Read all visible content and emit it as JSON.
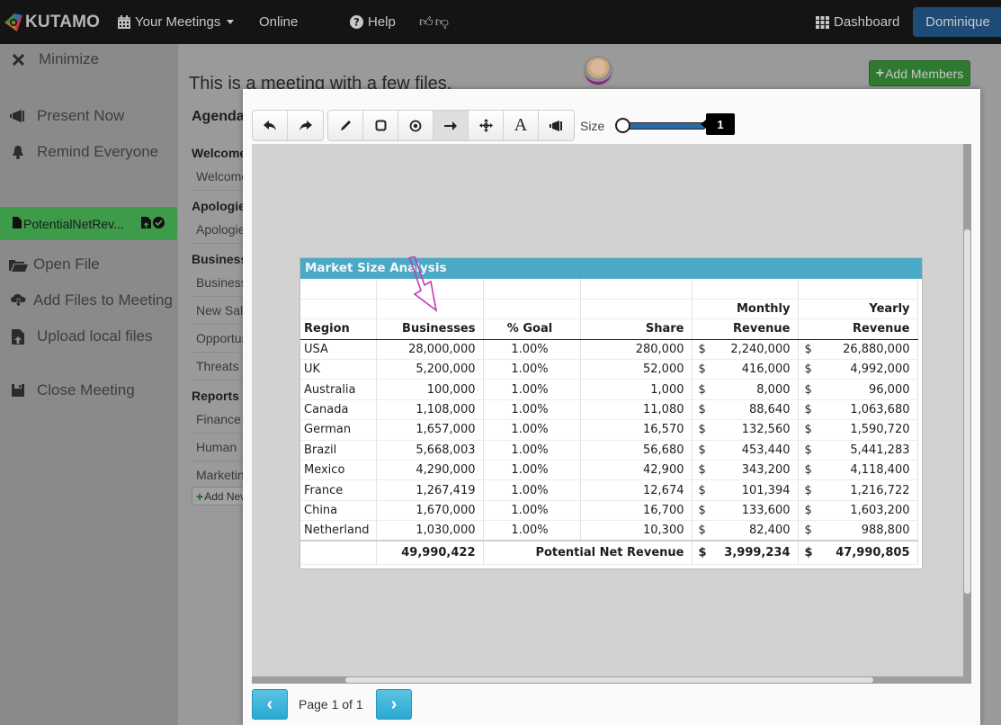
{
  "navbar": {
    "brand": "KUTAMO",
    "meetings_label": "Your Meetings",
    "online_label": "Online",
    "help_label": "Help",
    "dashboard_label": "Dashboard",
    "user_label": "Dominique"
  },
  "sidebar": {
    "minimize": "Minimize",
    "present_now": "Present Now",
    "remind_everyone": "Remind Everyone",
    "active_file": "PotentialNetRev...",
    "open_file": "Open File",
    "add_files": "Add Files to Meeting",
    "upload_local": "Upload local files",
    "close_meeting": "Close Meeting"
  },
  "meeting": {
    "title": "This is a meeting with a few files.",
    "add_members": "Add Members",
    "agenda_heading": "Agenda",
    "agenda_sections": [
      {
        "title": "Welcome",
        "items": [
          "Welcome"
        ]
      },
      {
        "title": "Apologies",
        "items": [
          "Apologies"
        ]
      },
      {
        "title": "Business",
        "items": [
          "Business",
          "New Sales",
          "Opportunities",
          "Threats"
        ]
      },
      {
        "title": "Reports",
        "items": [
          "Finance",
          "Human",
          "Marketing"
        ]
      }
    ],
    "add_new": "Add New"
  },
  "viewer": {
    "size_label": "Size",
    "size_value": "1",
    "size_fraction": 0,
    "page_label": "Page 1 of 1",
    "colors": {
      "accent": "#29a8d3",
      "slider": "#2e69a6",
      "sheet_header": "#4aa9c5",
      "annotation": "#c43bb8"
    }
  },
  "sheet": {
    "title": "Market Size Analysis",
    "header_top": [
      "",
      "",
      "",
      "",
      "Monthly",
      "Yearly"
    ],
    "headers": [
      "Region",
      "Businesses",
      "% Goal",
      "Share",
      "Revenue",
      "Revenue"
    ],
    "currency": "$",
    "rows": [
      {
        "region": "USA",
        "businesses": "28,000,000",
        "goal": "1.00%",
        "share": "280,000",
        "monthly": "2,240,000",
        "yearly": "26,880,000"
      },
      {
        "region": "UK",
        "businesses": "5,200,000",
        "goal": "1.00%",
        "share": "52,000",
        "monthly": "416,000",
        "yearly": "4,992,000"
      },
      {
        "region": "Australia",
        "businesses": "100,000",
        "goal": "1.00%",
        "share": "1,000",
        "monthly": "8,000",
        "yearly": "96,000"
      },
      {
        "region": "Canada",
        "businesses": "1,108,000",
        "goal": "1.00%",
        "share": "11,080",
        "monthly": "88,640",
        "yearly": "1,063,680"
      },
      {
        "region": "German",
        "businesses": "1,657,000",
        "goal": "1.00%",
        "share": "16,570",
        "monthly": "132,560",
        "yearly": "1,590,720"
      },
      {
        "region": "Brazil",
        "businesses": "5,668,003",
        "goal": "1.00%",
        "share": "56,680",
        "monthly": "453,440",
        "yearly": "5,441,283"
      },
      {
        "region": "Mexico",
        "businesses": "4,290,000",
        "goal": "1.00%",
        "share": "42,900",
        "monthly": "343,200",
        "yearly": "4,118,400"
      },
      {
        "region": "France",
        "businesses": "1,267,419",
        "goal": "1.00%",
        "share": "12,674",
        "monthly": "101,394",
        "yearly": "1,216,722"
      },
      {
        "region": "China",
        "businesses": "1,670,000",
        "goal": "1.00%",
        "share": "16,700",
        "monthly": "133,600",
        "yearly": "1,603,200"
      },
      {
        "region": "Netherland",
        "businesses": "1,030,000",
        "goal": "1.00%",
        "share": "10,300",
        "monthly": "82,400",
        "yearly": "988,800"
      }
    ],
    "total": {
      "businesses": "49,990,422",
      "label": "Potential Net Revenue",
      "monthly": "3,999,234",
      "yearly": "47,990,805"
    }
  }
}
